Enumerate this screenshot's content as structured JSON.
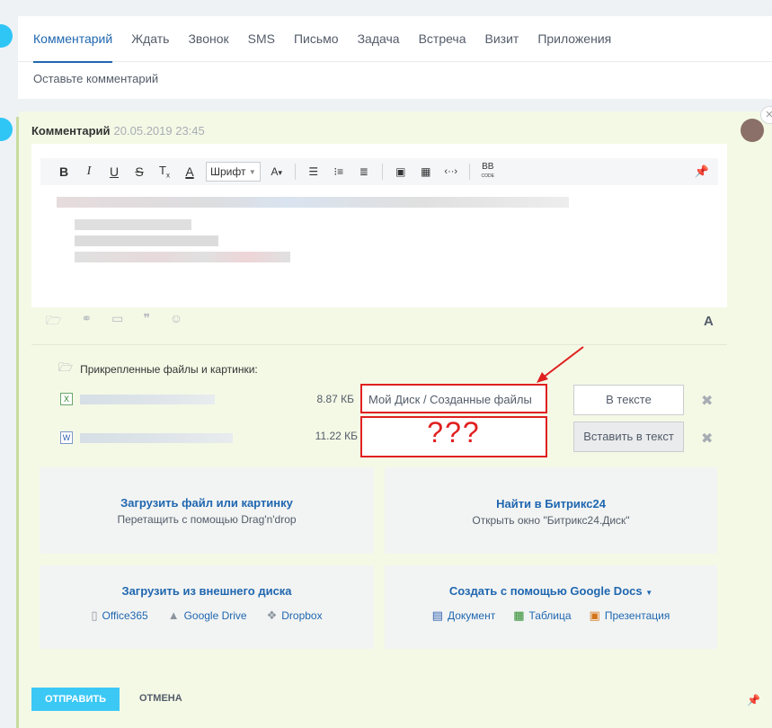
{
  "tabs": [
    {
      "label": "Комментарий"
    },
    {
      "label": "Ждать"
    },
    {
      "label": "Звонок"
    },
    {
      "label": "SMS"
    },
    {
      "label": "Письмо"
    },
    {
      "label": "Задача"
    },
    {
      "label": "Встреча"
    },
    {
      "label": "Визит"
    },
    {
      "label": "Приложения"
    }
  ],
  "composer": {
    "placeholder": "Оставьте комментарий"
  },
  "entry": {
    "title": "Комментарий",
    "datetime": "20.05.2019 23:45"
  },
  "toolbar": {
    "font_label": "Шрифт",
    "bb_label": "BB",
    "bb_sub": "CODE"
  },
  "attachments": {
    "header": "Прикрепленные файлы и картинки:",
    "files": [
      {
        "size": "8.87 КБ",
        "location": "Мой Диск / Созданные файлы",
        "button": "В тексте"
      },
      {
        "size": "11.22 КБ",
        "location": "???",
        "button": "Вставить в текст"
      }
    ]
  },
  "upload": {
    "local_title": "Загрузить файл или картинку",
    "local_sub": "Перетащить с помощью Drag'n'drop",
    "b24_title": "Найти в Битрикс24",
    "b24_sub": "Открыть окно \"Битрикс24.Диск\"",
    "ext_title": "Загрузить из внешнего диска",
    "ext_links": [
      "Office365",
      "Google Drive",
      "Dropbox"
    ],
    "gdocs_title": "Создать с помощью Google Docs",
    "gdocs_links": [
      "Документ",
      "Таблица",
      "Презентация"
    ]
  },
  "actions": {
    "send": "ОТПРАВИТЬ",
    "cancel": "ОТМЕНА"
  },
  "colors": {
    "accent": "#2067b0",
    "send": "#3bc8f5",
    "highlight": "#e02020"
  }
}
